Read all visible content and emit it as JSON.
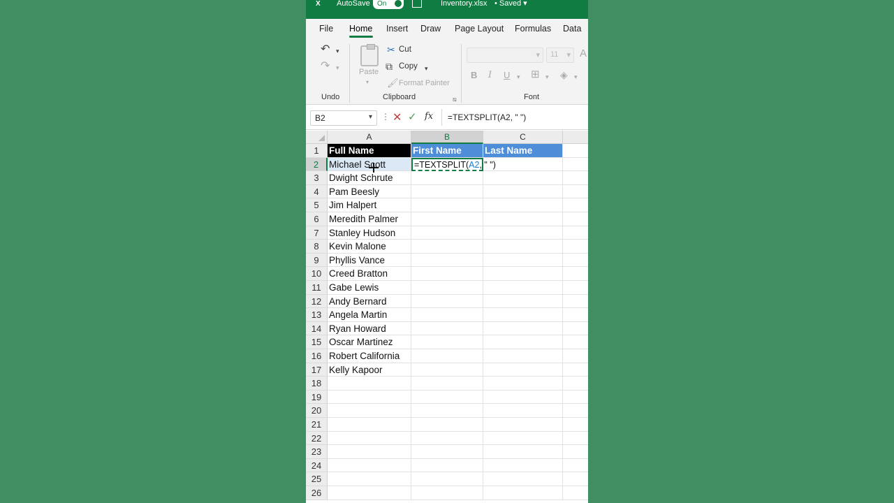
{
  "titlebar": {
    "autosave_label": "AutoSave",
    "toggle_state": "On",
    "filename": "Inventory.xlsx",
    "status": "• Saved"
  },
  "tabs": [
    "File",
    "Home",
    "Insert",
    "Draw",
    "Page Layout",
    "Formulas",
    "Data"
  ],
  "ribbon": {
    "undo_group": "Undo",
    "clipboard": {
      "paste": "Paste",
      "cut": "Cut",
      "copy": "Copy",
      "format_painter": "Format Painter",
      "group": "Clipboard"
    },
    "font": {
      "size": "11",
      "group": "Font"
    }
  },
  "formula_bar": {
    "name_box": "B2",
    "formula": "=TEXTSPLIT(A2, \" \")"
  },
  "sheet": {
    "columns": [
      "A",
      "B",
      "C"
    ],
    "headers": {
      "A1": "Full Name",
      "B1": "First Name",
      "C1": "Last Name"
    },
    "active_cell": {
      "prefix": "=TEXTSPLIT(",
      "ref": "A2",
      "suffix": ", \" \")"
    },
    "names": [
      "Michael Scott",
      "Dwight Schrute",
      "Pam Beesly",
      "Jim Halpert",
      "Meredith Palmer",
      "Stanley Hudson",
      "Kevin Malone",
      "Phyllis Vance",
      "Creed Bratton",
      "Gabe Lewis",
      "Andy Bernard",
      "Angela Martin",
      "Ryan Howard",
      "Oscar Martinez",
      "Robert California",
      "Kelly Kapoor"
    ],
    "row_numbers": [
      "1",
      "2",
      "3",
      "4",
      "5",
      "6",
      "7",
      "8",
      "9",
      "10",
      "11",
      "12",
      "13",
      "14",
      "15",
      "16",
      "17",
      "18",
      "19",
      "20",
      "21",
      "22",
      "23",
      "24",
      "25",
      "26"
    ]
  },
  "colors": {
    "excel_green": "#107c41",
    "background": "#418e62",
    "header_blue": "#4e8ed8",
    "header_black": "#000000"
  }
}
